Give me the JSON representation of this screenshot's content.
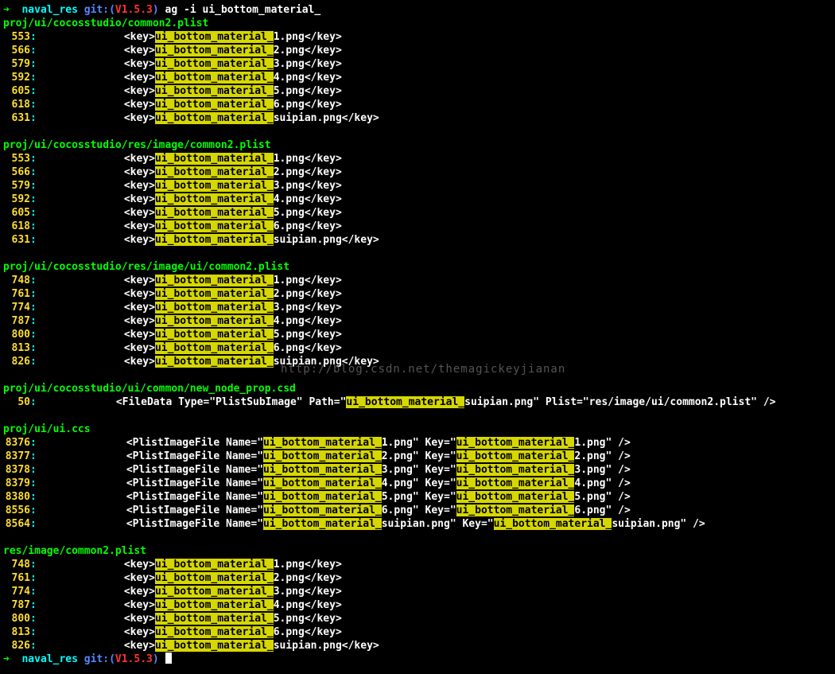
{
  "prompt": {
    "arrow": "➜",
    "cwd": "naval_res",
    "git_label": "git:(",
    "git_version": "V1.5.3",
    "git_close": ")",
    "command": "ag -i ui_bottom_material_"
  },
  "match_token": "ui_bottom_material_",
  "watermark": "http://blog.csdn.net/themagickeyjianan",
  "groups": [
    {
      "type": "keyfile",
      "path": "proj/ui/cocosstudio/common2.plist",
      "lines": [
        {
          "n": "553",
          "suffix": "1.png"
        },
        {
          "n": "566",
          "suffix": "2.png"
        },
        {
          "n": "579",
          "suffix": "3.png"
        },
        {
          "n": "592",
          "suffix": "4.png"
        },
        {
          "n": "605",
          "suffix": "5.png"
        },
        {
          "n": "618",
          "suffix": "6.png"
        },
        {
          "n": "631",
          "suffix": "suipian.png"
        }
      ]
    },
    {
      "type": "keyfile",
      "path": "proj/ui/cocosstudio/res/image/common2.plist",
      "lines": [
        {
          "n": "553",
          "suffix": "1.png"
        },
        {
          "n": "566",
          "suffix": "2.png"
        },
        {
          "n": "579",
          "suffix": "3.png"
        },
        {
          "n": "592",
          "suffix": "4.png"
        },
        {
          "n": "605",
          "suffix": "5.png"
        },
        {
          "n": "618",
          "suffix": "6.png"
        },
        {
          "n": "631",
          "suffix": "suipian.png"
        }
      ]
    },
    {
      "type": "keyfile",
      "path": "proj/ui/cocosstudio/res/image/ui/common2.plist",
      "lines": [
        {
          "n": "748",
          "suffix": "1.png"
        },
        {
          "n": "761",
          "suffix": "2.png"
        },
        {
          "n": "774",
          "suffix": "3.png"
        },
        {
          "n": "787",
          "suffix": "4.png"
        },
        {
          "n": "800",
          "suffix": "5.png"
        },
        {
          "n": "813",
          "suffix": "6.png"
        },
        {
          "n": "826",
          "suffix": "suipian.png"
        }
      ]
    },
    {
      "type": "csd",
      "path": "proj/ui/cocosstudio/ui/common/new_node_prop.csd",
      "lines": [
        {
          "n": "50",
          "pre": "<FileData Type=\"PlistSubImage\" Path=\"",
          "suffix": "suipian.png\" Plist=\"res/image/ui/common2.plist\" />"
        }
      ]
    },
    {
      "type": "ccs",
      "path": "proj/ui/ui.ccs",
      "lines": [
        {
          "n": "8376",
          "suffix": "1.png"
        },
        {
          "n": "8377",
          "suffix": "2.png"
        },
        {
          "n": "8378",
          "suffix": "3.png"
        },
        {
          "n": "8379",
          "suffix": "4.png"
        },
        {
          "n": "8380",
          "suffix": "5.png"
        },
        {
          "n": "8556",
          "suffix": "6.png"
        },
        {
          "n": "8564",
          "suffix": "suipian.png"
        }
      ]
    },
    {
      "type": "keyfile",
      "path": "res/image/common2.plist",
      "lines": [
        {
          "n": "748",
          "suffix": "1.png"
        },
        {
          "n": "761",
          "suffix": "2.png"
        },
        {
          "n": "774",
          "suffix": "3.png"
        },
        {
          "n": "787",
          "suffix": "4.png"
        },
        {
          "n": "800",
          "suffix": "5.png"
        },
        {
          "n": "813",
          "suffix": "6.png"
        },
        {
          "n": "826",
          "suffix": "suipian.png"
        }
      ]
    }
  ]
}
